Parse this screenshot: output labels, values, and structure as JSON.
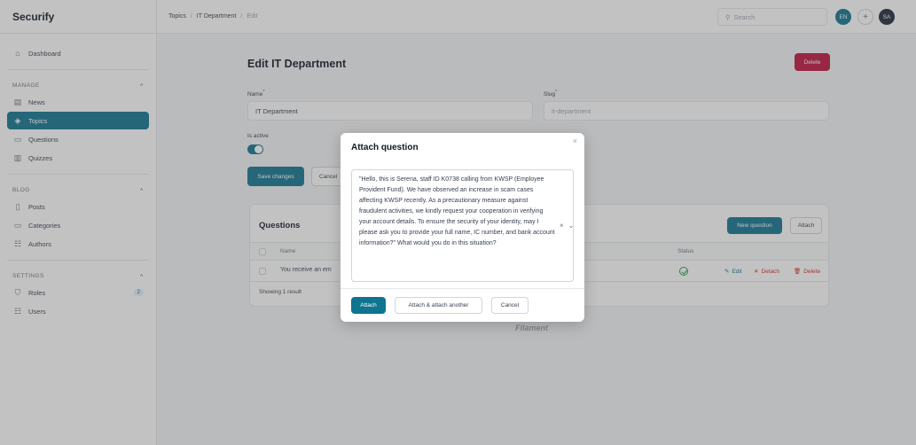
{
  "app": {
    "brand": "Securify"
  },
  "sidebar": {
    "dashboard": "Dashboard",
    "groups": {
      "manage": "MANAGE",
      "blog": "BLOG",
      "settings": "SETTINGS"
    },
    "manage_items": [
      {
        "label": "News",
        "icon": "newspaper-icon"
      },
      {
        "label": "Topics",
        "icon": "tag-icon",
        "active": true
      },
      {
        "label": "Questions",
        "icon": "folder-icon"
      },
      {
        "label": "Quizzes",
        "icon": "columns-icon"
      }
    ],
    "blog_items": [
      {
        "label": "Posts",
        "icon": "document-icon"
      },
      {
        "label": "Categories",
        "icon": "folder-icon"
      },
      {
        "label": "Authors",
        "icon": "users-icon"
      }
    ],
    "settings_items": [
      {
        "label": "Roles",
        "icon": "shield-icon",
        "badge": "2"
      },
      {
        "label": "Users",
        "icon": "user-group-icon"
      }
    ]
  },
  "topbar": {
    "breadcrumbs": [
      "Topics",
      "IT Department",
      "Edit"
    ],
    "search_placeholder": "Search",
    "lang_initials": "EN",
    "plus": "+",
    "user_initials": "SA"
  },
  "form": {
    "title": "Edit IT Department",
    "delete_label": "Delete",
    "name_label": "Name",
    "name_value": "IT Department",
    "slug_label": "Slug",
    "slug_value": "it-department",
    "active_label": "Is active",
    "is_active": true,
    "save_label": "Save changes",
    "cancel_label": "Cancel"
  },
  "questions": {
    "title": "Questions",
    "new_label": "New question",
    "attach_label": "Attach",
    "col_name": "Name",
    "col_status": "Status",
    "row_name": "You receive an em",
    "row_status_icon": "check-circle-icon",
    "edit_label": "Edit",
    "detach_label": "Detach",
    "delete_label": "Delete",
    "showing": "Showing 1 result"
  },
  "footer": {
    "brand": "Filament"
  },
  "modal": {
    "title": "Attach question",
    "close": "×",
    "selected_text": "\"Hello, this is Serena, staff ID K0738 calling from KWSP (Employee Provident Fund). We have observed an increase in scam cases affecting KWSP recently. As a precautionary measure against fraudulent activities, we kindly request your cooperation in verifying your account details. To ensure the security of your identity, may I please ask you to provide your full name, IC number, and bank account information?\" What would you do in this situation?",
    "clear": "×",
    "chevron": "⌄",
    "attach_label": "Attach",
    "attach_another_label": "Attach & attach another",
    "cancel_label": "Cancel"
  }
}
